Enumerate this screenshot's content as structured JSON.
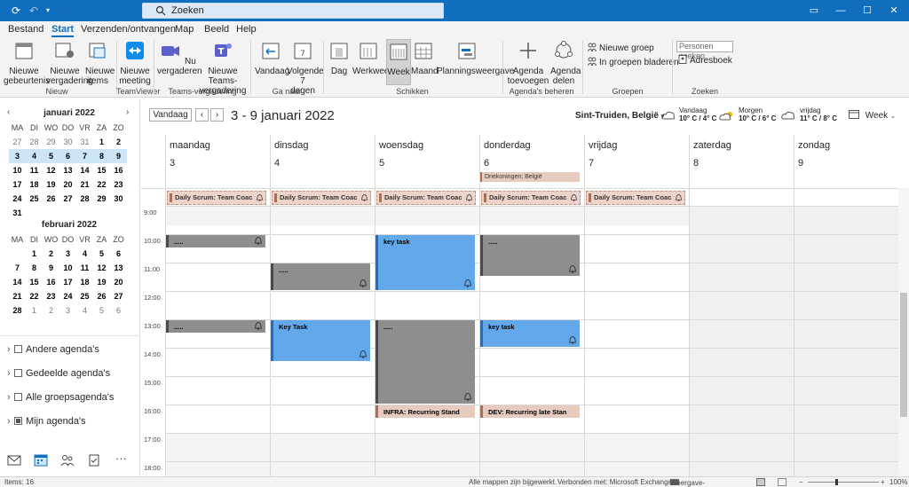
{
  "titlebar": {
    "search_placeholder": "Zoeken"
  },
  "menu": [
    "Bestand",
    "Start",
    "Verzenden/ontvangen",
    "Map",
    "Beeld",
    "Help"
  ],
  "ribbon": {
    "buttons": {
      "new_appt": "Nieuwe gebeurtenis",
      "new_meeting": "Nieuwe vergadering",
      "new_items": "Nieuwe items",
      "tv_meeting": "Nieuwe meeting",
      "meet_now": "Nu vergaderen",
      "teams_meeting": "Nieuwe Teams-vergadering",
      "today": "Vandaag",
      "next7": "Volgende 7 dagen",
      "day": "Dag",
      "workweek": "Werkweek",
      "week": "Week",
      "month": "Maand",
      "schedule": "Planningsweergave",
      "add_cal": "Agenda toevoegen",
      "share_cal": "Agenda delen",
      "new_group": "Nieuwe groep",
      "browse_groups": "In groepen bladeren",
      "search_people": "Personen zoeken",
      "address_book": "Adresboek"
    },
    "groups": {
      "new": "Nieuw",
      "teamviewer": "TeamViewer",
      "teams": "Teams-vergadering",
      "goto": "Ga naar",
      "arrange": "Schikken",
      "manage": "Agenda's beheren",
      "groups": "Groepen",
      "find": "Zoeken"
    }
  },
  "minical": {
    "january": {
      "title": "januari 2022",
      "headers": [
        "MA",
        "DI",
        "WO",
        "DO",
        "VR",
        "ZA",
        "ZO"
      ],
      "days": [
        "27",
        "28",
        "29",
        "30",
        "31",
        "1",
        "2",
        "3",
        "4",
        "5",
        "6",
        "7",
        "8",
        "9",
        "10",
        "11",
        "12",
        "13",
        "14",
        "15",
        "16",
        "17",
        "18",
        "19",
        "20",
        "21",
        "22",
        "23",
        "24",
        "25",
        "26",
        "27",
        "28",
        "29",
        "30",
        "31"
      ]
    },
    "february": {
      "title": "februari 2022",
      "headers": [
        "MA",
        "DI",
        "WO",
        "DO",
        "VR",
        "ZA",
        "ZO"
      ],
      "days": [
        "",
        "1",
        "2",
        "3",
        "4",
        "5",
        "6",
        "7",
        "8",
        "9",
        "10",
        "11",
        "12",
        "13",
        "14",
        "15",
        "16",
        "17",
        "18",
        "19",
        "20",
        "21",
        "22",
        "23",
        "24",
        "25",
        "26",
        "27",
        "28",
        "1",
        "2",
        "3",
        "4",
        "5",
        "6"
      ]
    }
  },
  "calendar_groups": [
    {
      "label": "Andere agenda's",
      "checked": false
    },
    {
      "label": "Gedeelde agenda's",
      "checked": false
    },
    {
      "label": "Alle groepsagenda's",
      "checked": false
    },
    {
      "label": "Mijn agenda's",
      "checked": true
    }
  ],
  "view": {
    "today_button": "Vandaag",
    "range": "3 - 9 januari 2022",
    "location": "Sint-Truiden, België",
    "weather": [
      {
        "day": "Vandaag",
        "temp": "10° C / 4° C"
      },
      {
        "day": "Morgen",
        "temp": "10° C / 6° C"
      },
      {
        "day": "vrijdag",
        "temp": "11° C / 8° C"
      }
    ],
    "view_mode": "Week"
  },
  "days": [
    {
      "name": "maandag",
      "date": "3"
    },
    {
      "name": "dinsdag",
      "date": "4"
    },
    {
      "name": "woensdag",
      "date": "5"
    },
    {
      "name": "donderdag",
      "date": "6"
    },
    {
      "name": "vrijdag",
      "date": "7"
    },
    {
      "name": "zaterdag",
      "date": "8"
    },
    {
      "name": "zondag",
      "date": "9"
    }
  ],
  "holiday": "Driekoningen; België",
  "scrum_label": "Daily Scrum: Team Coac",
  "hours": [
    "9:00",
    "10:00",
    "11:00",
    "12:00",
    "13:00",
    "14:00",
    "15:00",
    "16:00",
    "17:00",
    "18:00"
  ],
  "events": {
    "mon_10": ".....",
    "mon_13": ".....",
    "tue_11": ".....",
    "tue_13": "Key Task",
    "wed_10": "key task",
    "wed_13": ".....",
    "wed_16": "INFRA: Recurring  Stand",
    "thu_10": ".....",
    "thu_13": "key task",
    "thu_16": "DEV: Recurring late Stan"
  },
  "status": {
    "items": "Items: 16",
    "updated": "Alle mappen zijn bijgewerkt.",
    "connected": "Verbonden met: Microsoft Exchange",
    "display_settings": "Weergave-instellingen",
    "zoom": "100%"
  }
}
